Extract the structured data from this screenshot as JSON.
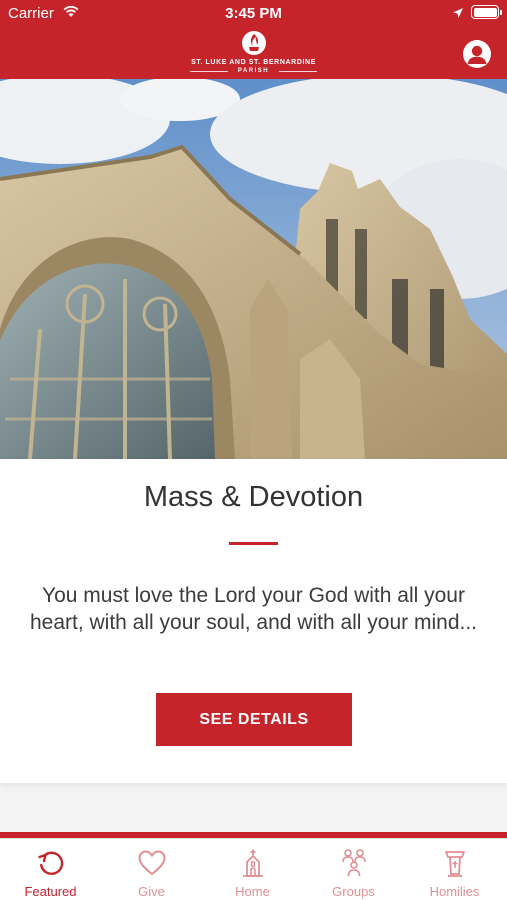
{
  "status_bar": {
    "carrier": "Carrier",
    "time": "3:45 PM"
  },
  "header": {
    "logo_line1": "ST. LUKE AND ST. BERNARDINE",
    "logo_line2": "PARISH",
    "icons": [
      "wifi-icon",
      "location-arrow-icon",
      "battery-icon",
      "parish-logo-icon",
      "profile-icon"
    ]
  },
  "hero": {
    "image": "church-facade-photo"
  },
  "featured_card": {
    "title": "Mass & Devotion",
    "body": "You must love the Lord your God with all your heart, with all your soul, and with all your mind...",
    "button_label": "SEE DETAILS"
  },
  "tabs": [
    {
      "label": "Featured",
      "icon": "featured-refresh-icon",
      "active": true
    },
    {
      "label": "Give",
      "icon": "heart-icon",
      "active": false
    },
    {
      "label": "Home",
      "icon": "church-icon",
      "active": false
    },
    {
      "label": "Groups",
      "icon": "groups-icon",
      "active": false
    },
    {
      "label": "Homilies",
      "icon": "pulpit-icon",
      "active": false
    }
  ],
  "colors": {
    "brand": "#c5242b",
    "tab_inactive": "#e28f93",
    "text": "#333333"
  }
}
